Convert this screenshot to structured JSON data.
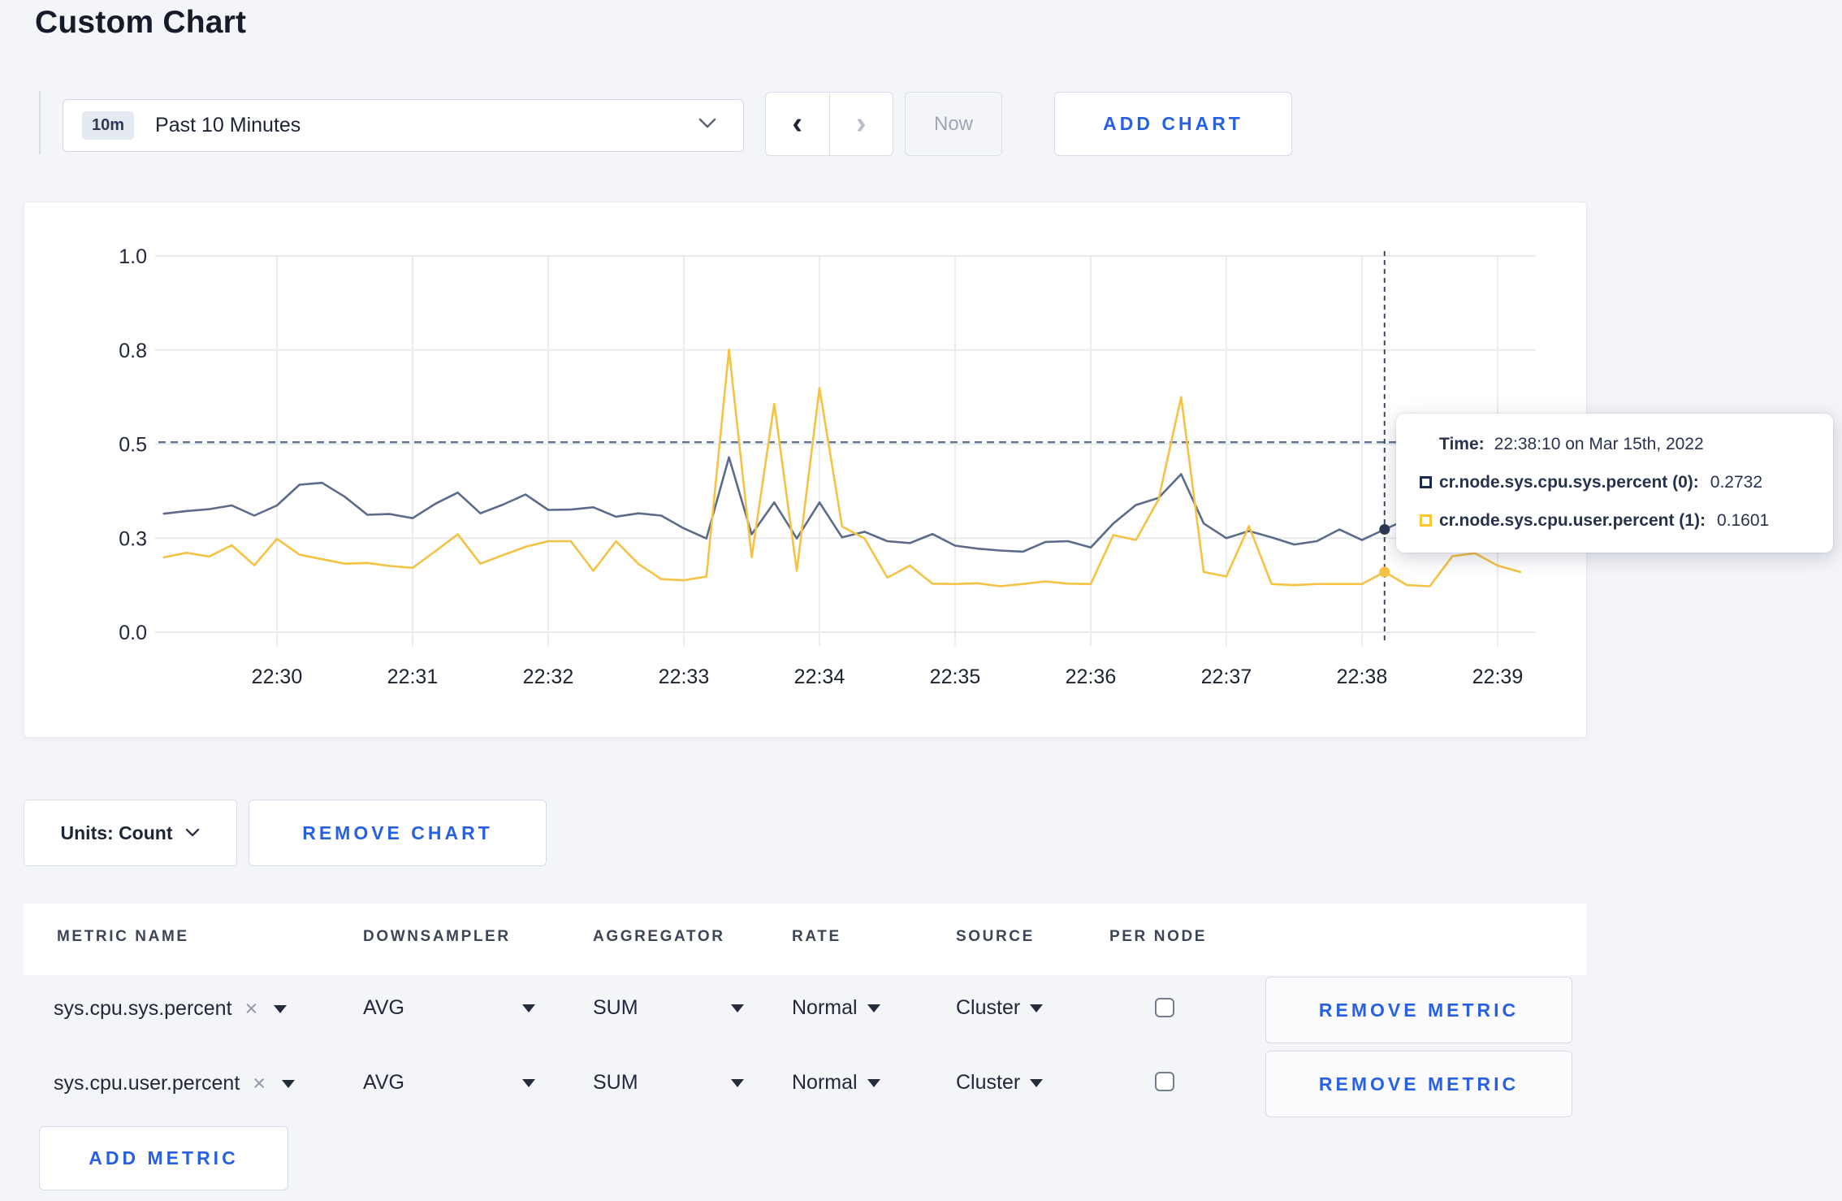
{
  "page": {
    "title": "Custom Chart"
  },
  "toolbar": {
    "time_badge": "10m",
    "time_label": "Past 10 Minutes",
    "prev_label": "‹",
    "next_label": "›",
    "now_label": "Now",
    "add_chart_label": "ADD CHART"
  },
  "chart_controls": {
    "units_label": "Units: Count",
    "remove_chart_label": "REMOVE CHART"
  },
  "tooltip": {
    "time_label": "Time:",
    "time_value": "22:38:10 on Mar 15th, 2022",
    "series": [
      {
        "label": "cr.node.sys.cpu.sys.percent (0):",
        "value": "0.2732",
        "marker_color": "#1b2b4e"
      },
      {
        "label": "cr.node.sys.cpu.user.percent (1):",
        "value": "0.1601",
        "marker_color": "#ffc72e"
      }
    ]
  },
  "metrics_table": {
    "headers": [
      "METRIC NAME",
      "DOWNSAMPLER",
      "AGGREGATOR",
      "RATE",
      "SOURCE",
      "PER NODE"
    ],
    "remove_icon": "×",
    "rows": [
      {
        "metric": "sys.cpu.sys.percent",
        "downsampler": "AVG",
        "aggregator": "SUM",
        "rate": "Normal",
        "source": "Cluster",
        "per_node": false,
        "remove_label": "REMOVE METRIC"
      },
      {
        "metric": "sys.cpu.user.percent",
        "downsampler": "AVG",
        "aggregator": "SUM",
        "rate": "Normal",
        "source": "Cluster",
        "per_node": false,
        "remove_label": "REMOVE METRIC"
      }
    ],
    "add_metric_label": "ADD METRIC"
  },
  "chart_data": {
    "type": "line",
    "grid": true,
    "legend_position": "none",
    "first_point_time": "22:29:10",
    "start_time_s": 0,
    "interval_s": 10,
    "x_axis": {
      "ticks": [
        "22:30",
        "22:31",
        "22:32",
        "22:33",
        "22:34",
        "22:35",
        "22:36",
        "22:37",
        "22:38",
        "22:39"
      ],
      "tick_times_s": [
        50,
        110,
        170,
        230,
        290,
        350,
        410,
        470,
        530,
        590
      ]
    },
    "y_axis": {
      "range": [
        0,
        1
      ],
      "tick_values": [
        0,
        0.25,
        0.5,
        0.75,
        1.0
      ],
      "tick_labels": [
        "0.0",
        "0.3",
        "0.5",
        "0.8",
        "1.0"
      ]
    },
    "threshold_line": {
      "value": 0.505,
      "style": "dashed",
      "color": "#5e7492"
    },
    "crosshair": {
      "time_s": 540,
      "time_label": "22:38:10",
      "points": [
        {
          "series": 0,
          "value": 0.2732,
          "dot_color": "#2c3850"
        },
        {
          "series": 1,
          "value": 0.1601,
          "dot_color": "#f5c243"
        }
      ]
    },
    "series": [
      {
        "name": "cr.node.sys.cpu.sys.percent",
        "color": "#5b6b89",
        "values": [
          0.315,
          0.322,
          0.327,
          0.337,
          0.31,
          0.337,
          0.392,
          0.397,
          0.36,
          0.312,
          0.314,
          0.303,
          0.341,
          0.371,
          0.316,
          0.339,
          0.366,
          0.325,
          0.326,
          0.332,
          0.307,
          0.316,
          0.31,
          0.276,
          0.249,
          0.465,
          0.26,
          0.345,
          0.249,
          0.345,
          0.252,
          0.267,
          0.242,
          0.237,
          0.261,
          0.23,
          0.222,
          0.217,
          0.214,
          0.24,
          0.242,
          0.225,
          0.289,
          0.338,
          0.357,
          0.42,
          0.289,
          0.25,
          0.269,
          0.252,
          0.233,
          0.242,
          0.273,
          0.245,
          0.2732,
          0.3,
          0.31,
          0.295,
          0.3,
          0.31,
          0.3
        ]
      },
      {
        "name": "cr.node.sys.cpu.user.percent",
        "color": "#f5c243",
        "values": [
          0.199,
          0.211,
          0.201,
          0.231,
          0.178,
          0.248,
          0.206,
          0.194,
          0.182,
          0.184,
          0.176,
          0.171,
          0.215,
          0.26,
          0.182,
          0.205,
          0.227,
          0.242,
          0.242,
          0.163,
          0.242,
          0.181,
          0.141,
          0.138,
          0.148,
          0.751,
          0.199,
          0.607,
          0.163,
          0.649,
          0.281,
          0.249,
          0.145,
          0.177,
          0.129,
          0.128,
          0.13,
          0.122,
          0.128,
          0.135,
          0.129,
          0.128,
          0.258,
          0.245,
          0.353,
          0.625,
          0.16,
          0.148,
          0.282,
          0.128,
          0.125,
          0.128,
          0.128,
          0.128,
          0.1601,
          0.125,
          0.122,
          0.202,
          0.21,
          0.177,
          0.16
        ]
      }
    ]
  }
}
